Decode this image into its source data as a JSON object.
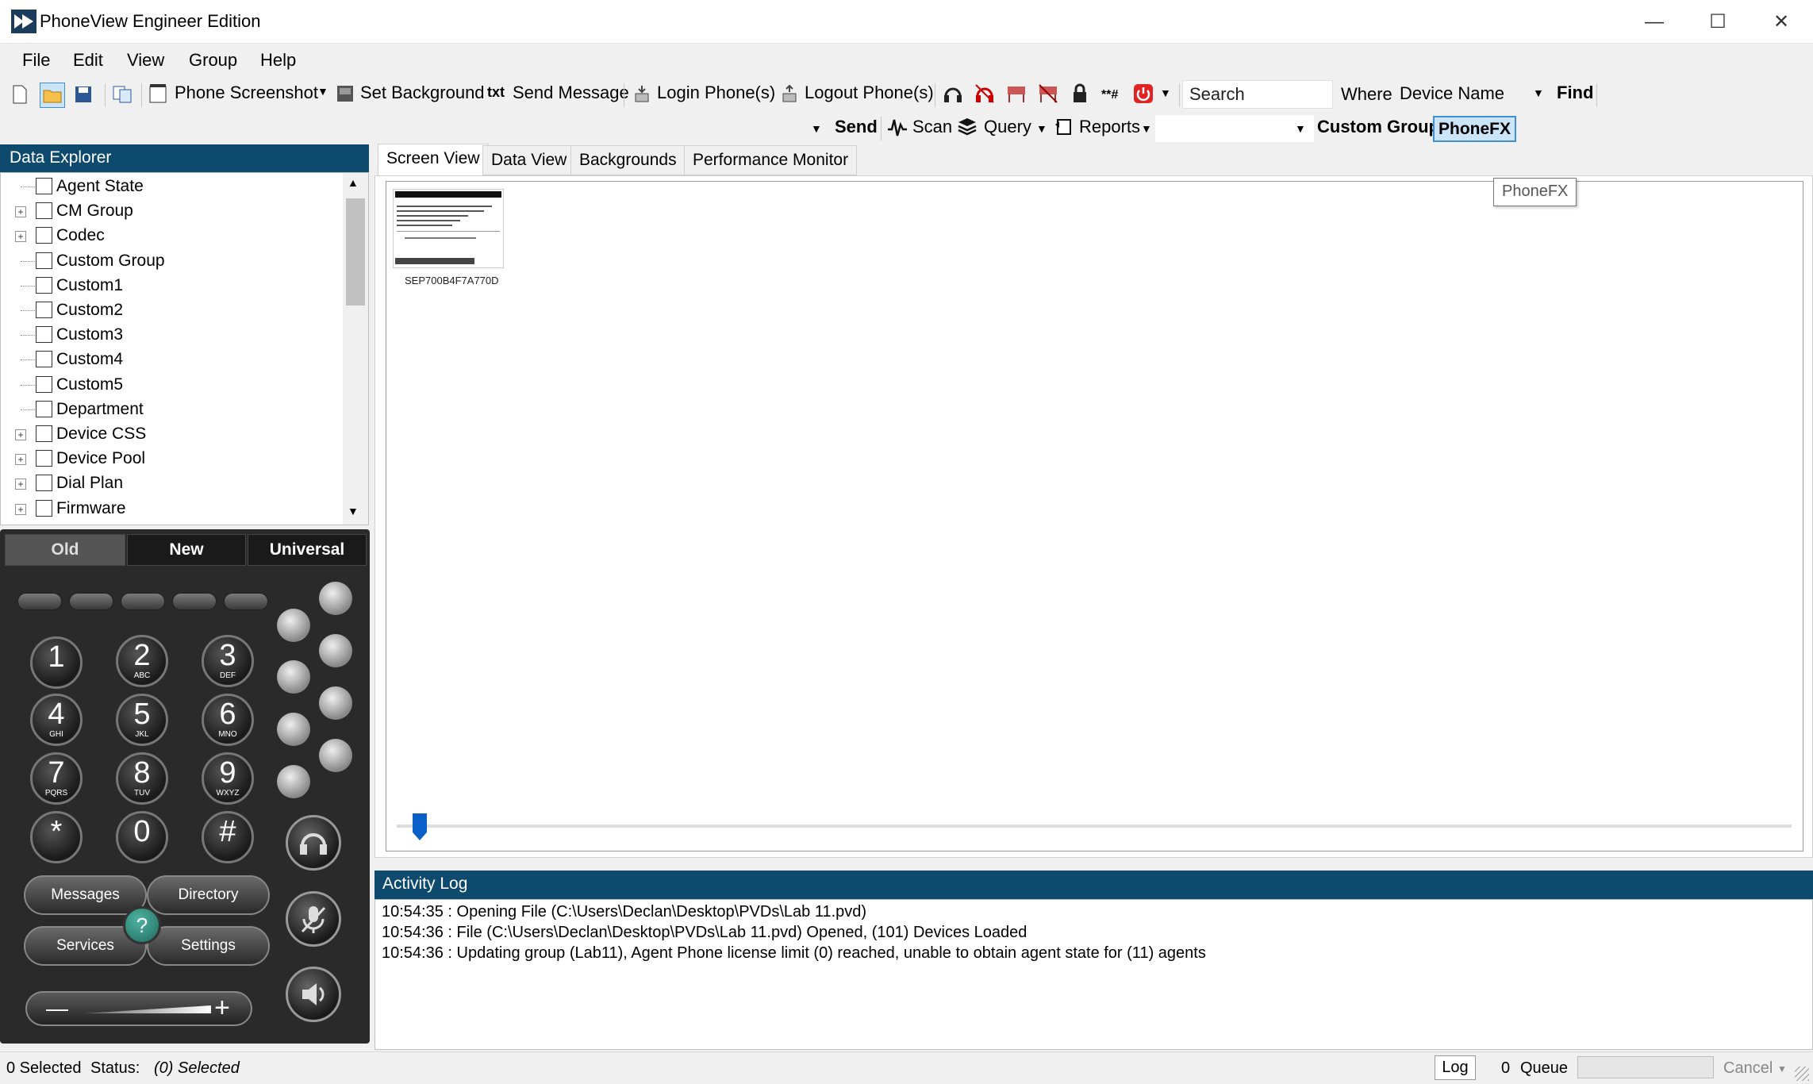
{
  "window": {
    "title": "PhoneView Engineer Edition",
    "minimize": "—",
    "maximize": "☐",
    "close": "✕"
  },
  "menu": [
    "File",
    "Edit",
    "View",
    "Group",
    "Help"
  ],
  "toolbar1": {
    "phone_screenshot": "Phone Screenshot",
    "set_background": "Set Background",
    "send_message_icon": "txt",
    "send_message": "Send Message",
    "login": "Login Phone(s)",
    "logout": "Logout Phone(s)",
    "asterisk_icon": "**#",
    "search_placeholder": "Search",
    "where_label": "Where",
    "where_value": "Device Name",
    "find": "Find"
  },
  "toolbar2": {
    "send": "Send",
    "scan": "Scan",
    "query": "Query",
    "reports": "Reports",
    "custom_group": "Custom Group",
    "phonefx": "PhoneFX"
  },
  "data_explorer": {
    "title": "Data Explorer",
    "items": [
      {
        "label": "Agent State",
        "expandable": false
      },
      {
        "label": "CM Group",
        "expandable": true
      },
      {
        "label": "Codec",
        "expandable": true
      },
      {
        "label": "Custom Group",
        "expandable": false
      },
      {
        "label": "Custom1",
        "expandable": false
      },
      {
        "label": "Custom2",
        "expandable": false
      },
      {
        "label": "Custom3",
        "expandable": false
      },
      {
        "label": "Custom4",
        "expandable": false
      },
      {
        "label": "Custom5",
        "expandable": false
      },
      {
        "label": "Department",
        "expandable": false
      },
      {
        "label": "Device CSS",
        "expandable": true
      },
      {
        "label": "Device Pool",
        "expandable": true
      },
      {
        "label": "Dial Plan",
        "expandable": true
      },
      {
        "label": "Firmware",
        "expandable": true
      }
    ]
  },
  "phone": {
    "tabs": [
      "Old",
      "New",
      "Universal"
    ],
    "keys": [
      {
        "n": "1",
        "s": ""
      },
      {
        "n": "2",
        "s": "ABC"
      },
      {
        "n": "3",
        "s": "DEF"
      },
      {
        "n": "4",
        "s": "GHI"
      },
      {
        "n": "5",
        "s": "JKL"
      },
      {
        "n": "6",
        "s": "MNO"
      },
      {
        "n": "7",
        "s": "PQRS"
      },
      {
        "n": "8",
        "s": "TUV"
      },
      {
        "n": "9",
        "s": "WXYZ"
      },
      {
        "n": "*",
        "s": ""
      },
      {
        "n": "0",
        "s": ""
      },
      {
        "n": "#",
        "s": ""
      }
    ],
    "messages": "Messages",
    "directory": "Directory",
    "services": "Services",
    "settings": "Settings",
    "help": "?",
    "vol_minus": "—",
    "vol_plus": "+"
  },
  "main_tabs": [
    "Screen View",
    "Data View",
    "Backgrounds",
    "Performance Monitor"
  ],
  "screen_view": {
    "thumbnail_label": "SEP700B4F7A770D",
    "tooltip": "PhoneFX"
  },
  "activity_log": {
    "title": "Activity Log",
    "lines": [
      "10:54:35 : Opening File (C:\\Users\\Declan\\Desktop\\PVDs\\Lab 11.pvd)",
      "10:54:36 : File (C:\\Users\\Declan\\Desktop\\PVDs\\Lab 11.pvd) Opened, (101) Devices Loaded",
      "10:54:36 : Updating group (Lab11), Agent Phone license limit (0) reached, unable to obtain agent state for (11) agents"
    ]
  },
  "status": {
    "selected": "0 Selected",
    "status_label": "Status:",
    "status_value": "(0) Selected",
    "log": "Log",
    "queue_count": "0",
    "queue_label": "Queue",
    "cancel": "Cancel"
  }
}
